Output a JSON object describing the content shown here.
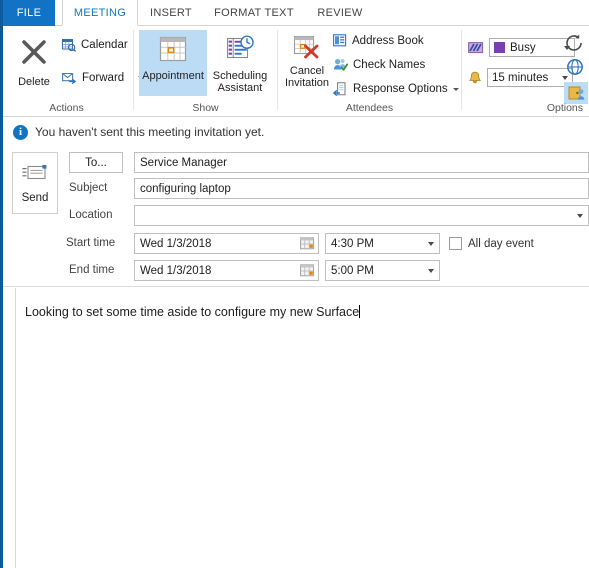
{
  "ribbon": {
    "tabs": [
      {
        "label": "FILE",
        "state": "file"
      },
      {
        "label": "MEETING",
        "state": "active"
      },
      {
        "label": "INSERT",
        "state": "normal"
      },
      {
        "label": "FORMAT TEXT",
        "state": "normal"
      },
      {
        "label": "REVIEW",
        "state": "normal"
      }
    ],
    "groups": [
      {
        "label": "Actions"
      },
      {
        "label": "Show"
      },
      {
        "label": "Attendees"
      },
      {
        "label": "Options"
      }
    ],
    "actions": {
      "delete_label": "Delete",
      "calendar_label": "Calendar",
      "forward_label": "Forward"
    },
    "show": {
      "appointment_label": "Appointment",
      "scheduling_assistant_label": "Scheduling Assistant",
      "selected": "Appointment"
    },
    "attendees": {
      "cancel_invitation_label": "Cancel Invitation",
      "address_book_label": "Address Book",
      "check_names_label": "Check Names",
      "response_options_label": "Response Options"
    },
    "options": {
      "show_as_value": "Busy",
      "show_as_color": "#7b3fb5",
      "reminder_value": "15 minutes"
    }
  },
  "infobar": {
    "icon": "info-icon",
    "message": "You haven't sent this meeting invitation yet."
  },
  "form": {
    "send_label": "Send",
    "to_button_label": "To...",
    "to_value": "Service Manager",
    "subject_label": "Subject",
    "subject_value": "configuring laptop",
    "location_label": "Location",
    "location_value": "",
    "start_time_label": "Start time",
    "start_date_value": "Wed 1/3/2018",
    "start_time_value": "4:30 PM",
    "end_time_label": "End time",
    "end_date_value": "Wed 1/3/2018",
    "end_time_value": "5:00 PM",
    "all_day_label": "All day event",
    "all_day_checked": false
  },
  "body": {
    "text": "Looking to set some time aside to configure my new Surface"
  },
  "colors": {
    "accent_blue": "#1273c4",
    "left_bar": "#0a5c9e",
    "selected_bg": "#bcdcf5"
  }
}
